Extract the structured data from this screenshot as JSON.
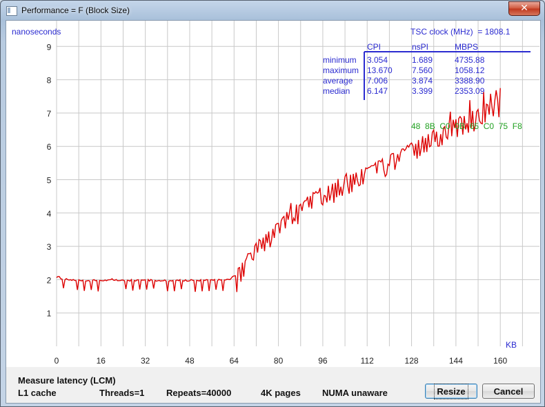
{
  "window": {
    "title": "Performance = F (Block Size)",
    "close_label": "✕"
  },
  "plot": {
    "y_unit": "nanoseconds",
    "x_unit": "KB",
    "tsc_label": "TSC clock (MHz)  = 1808.1",
    "stats": {
      "headers": [
        "CPI",
        "nsPI",
        "MBPS"
      ],
      "rows": [
        {
          "label": "minimum",
          "values": [
            "3.054",
            "1.689",
            "4735.88"
          ]
        },
        {
          "label": "maximum",
          "values": [
            "13.670",
            "7.560",
            "1058.12"
          ]
        },
        {
          "label": "average",
          "values": [
            "7.006",
            "3.874",
            "3388.90"
          ]
        },
        {
          "label": "median",
          "values": [
            "6.147",
            "3.399",
            "2353.09"
          ]
        }
      ]
    },
    "hex_pattern": "48  8B  C0  0B  65  C0  75  F8",
    "colors": {
      "series": "#dd0000",
      "stats_text": "#2a2ad0",
      "hex_text": "#1fa01f",
      "grid": "#c8c8c8",
      "axis_text": "#222222"
    }
  },
  "chart_data": {
    "type": "line",
    "xlabel": "KB",
    "ylabel": "nanoseconds",
    "xlim": [
      0,
      176
    ],
    "ylim": [
      0,
      10
    ],
    "x_ticks": [
      0,
      16,
      32,
      48,
      64,
      80,
      96,
      112,
      128,
      144,
      160
    ],
    "y_ticks": [
      1,
      2,
      3,
      4,
      5,
      6,
      7,
      8,
      9
    ],
    "grid": true,
    "series": [
      {
        "points": [
          [
            0,
            2.3
          ],
          [
            0.5,
            2.1
          ],
          [
            2,
            2.02
          ],
          [
            8,
            1.98
          ],
          [
            16,
            1.98
          ],
          [
            24,
            1.98
          ],
          [
            32,
            1.98
          ],
          [
            40,
            1.98
          ],
          [
            48,
            1.98
          ],
          [
            56,
            1.98
          ],
          [
            62,
            2.0
          ],
          [
            64,
            2.1
          ],
          [
            68,
            2.6
          ],
          [
            72,
            3.1
          ],
          [
            76,
            3.4
          ],
          [
            80,
            3.75
          ],
          [
            84,
            4.05
          ],
          [
            88,
            4.3
          ],
          [
            92,
            4.55
          ],
          [
            96,
            4.75
          ],
          [
            100,
            4.92
          ],
          [
            104,
            5.1
          ],
          [
            108,
            5.25
          ],
          [
            112,
            5.38
          ],
          [
            116,
            5.55
          ],
          [
            120,
            5.7
          ],
          [
            124,
            5.85
          ],
          [
            128,
            6.05
          ],
          [
            132,
            6.25
          ],
          [
            136,
            6.45
          ],
          [
            140,
            6.6
          ],
          [
            144,
            6.8
          ],
          [
            148,
            6.95
          ],
          [
            152,
            7.1
          ],
          [
            156,
            7.25
          ],
          [
            160,
            7.4
          ]
        ]
      }
    ]
  },
  "footer": {
    "test_name": "Measure latency (LCM)",
    "cache": "L1 cache",
    "threads": "Threads=1",
    "repeats": "Repeats=40000",
    "pages": "4K pages",
    "numa": "NUMA unaware",
    "resize_label": "Resize",
    "cancel_label": "Cancel"
  }
}
